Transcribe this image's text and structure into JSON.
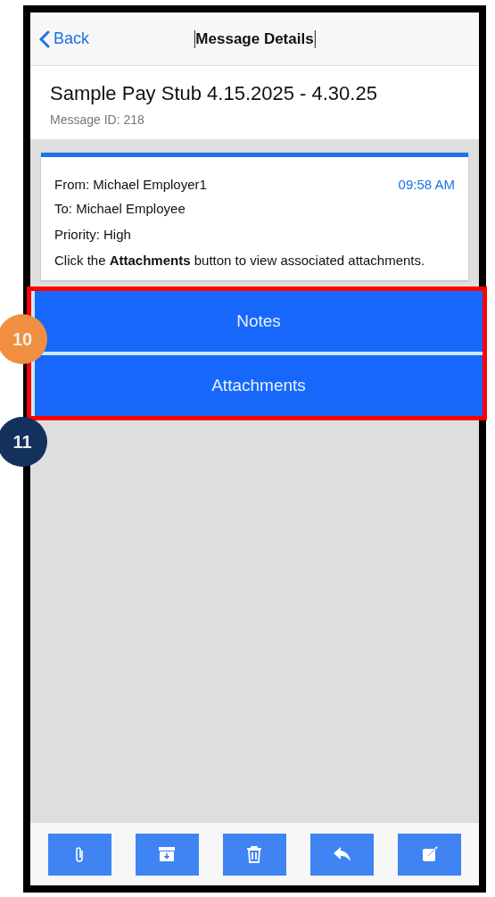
{
  "nav": {
    "back": "Back",
    "title": "Message Details"
  },
  "message": {
    "subject": "Sample Pay Stub 4.15.2025 - 4.30.25",
    "id_label": "Message ID: 218"
  },
  "card": {
    "from": "From: Michael Employer1",
    "time": "09:58 AM",
    "to": "To: Michael Employee",
    "priority": "Priority: High",
    "hint": "Click the **Attachments** button to view associated attachments."
  },
  "actions": [
    {
      "label": "Notes"
    },
    {
      "label": "Attachments"
    }
  ],
  "callouts": [
    {
      "label": "10",
      "color": "#ef8f3f"
    },
    {
      "label": "11",
      "color": "#14315e"
    }
  ],
  "toolbar": [
    {
      "kind": "attach"
    },
    {
      "kind": "archive"
    },
    {
      "kind": "delete"
    },
    {
      "kind": "reply"
    },
    {
      "kind": "compose"
    }
  ]
}
